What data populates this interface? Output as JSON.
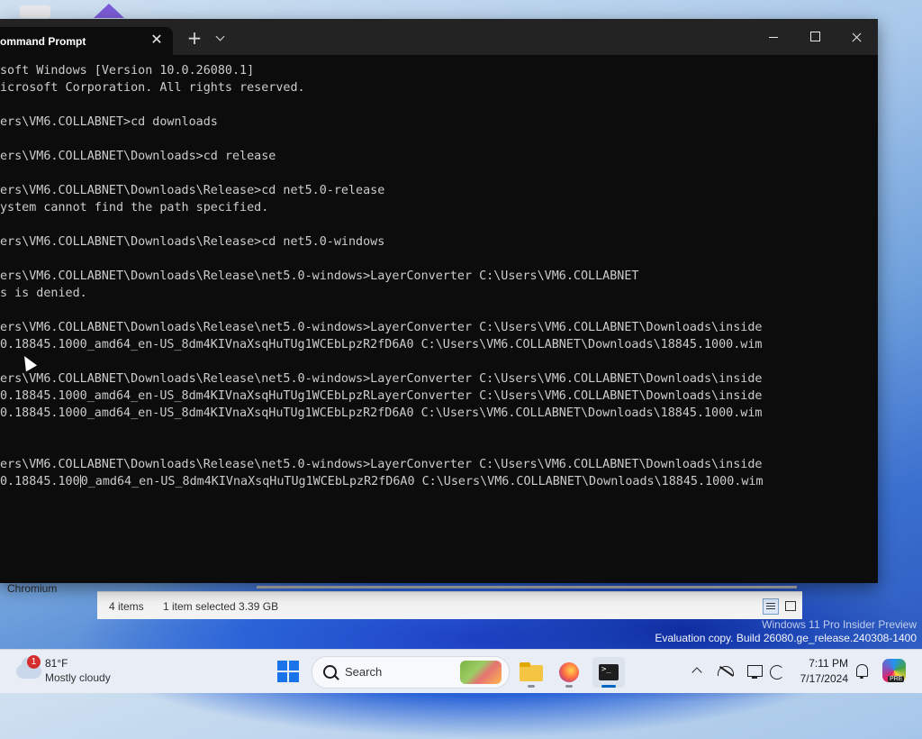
{
  "desktop": {
    "chromium_label": "Chromium",
    "watermark": {
      "line1": "Windows 11 Pro Insider Preview",
      "line2": "Evaluation copy. Build 26080.ge_release.240308-1400"
    }
  },
  "explorer_status": {
    "item_count": "4 items",
    "selected": "1 item selected  3.39 GB"
  },
  "terminal": {
    "tab_title": "ommand Prompt",
    "close_tab": "✕",
    "new_tab": "+",
    "lines": [
      "soft Windows [Version 10.0.26080.1]",
      "icrosoft Corporation. All rights reserved.",
      "",
      "ers\\VM6.COLLABNET>cd downloads",
      "",
      "ers\\VM6.COLLABNET\\Downloads>cd release",
      "",
      "ers\\VM6.COLLABNET\\Downloads\\Release>cd net5.0-release",
      "ystem cannot find the path specified.",
      "",
      "ers\\VM6.COLLABNET\\Downloads\\Release>cd net5.0-windows",
      "",
      "ers\\VM6.COLLABNET\\Downloads\\Release\\net5.0-windows>LayerConverter C:\\Users\\VM6.COLLABNET",
      "s is denied.",
      "",
      "ers\\VM6.COLLABNET\\Downloads\\Release\\net5.0-windows>LayerConverter C:\\Users\\VM6.COLLABNET\\Downloads\\inside",
      "0.18845.1000_amd64_en-US_8dm4KIVnaXsqHuTUg1WCEbLpzR2fD6A0 C:\\Users\\VM6.COLLABNET\\Downloads\\18845.1000.wim",
      "",
      "ers\\VM6.COLLABNET\\Downloads\\Release\\net5.0-windows>LayerConverter C:\\Users\\VM6.COLLABNET\\Downloads\\inside",
      "0.18845.1000_amd64_en-US_8dm4KIVnaXsqHuTUg1WCEbLpzRLayerConverter C:\\Users\\VM6.COLLABNET\\Downloads\\inside",
      "0.18845.1000_amd64_en-US_8dm4KIVnaXsqHuTUg1WCEbLpzR2fD6A0 C:\\Users\\VM6.COLLABNET\\Downloads\\18845.1000.wim",
      "",
      "",
      "ers\\VM6.COLLABNET\\Downloads\\Release\\net5.0-windows>LayerConverter C:\\Users\\VM6.COLLABNET\\Downloads\\inside"
    ],
    "last_line_before_cursor": "0.18845.100",
    "last_line_after_cursor": "0_amd64_en-US_8dm4KIVnaXsqHuTUg1WCEbLpzR2fD6A0 C:\\Users\\VM6.COLLABNET\\Downloads\\18845.1000.wim"
  },
  "taskbar": {
    "weather": {
      "badge": "1",
      "temp": "81°F",
      "condition": "Mostly cloudy"
    },
    "search_label": "Search",
    "clock": {
      "time": "7:11 PM",
      "date": "7/17/2024"
    },
    "copilot_badge": "PRE",
    "accent": "#0067c0"
  }
}
